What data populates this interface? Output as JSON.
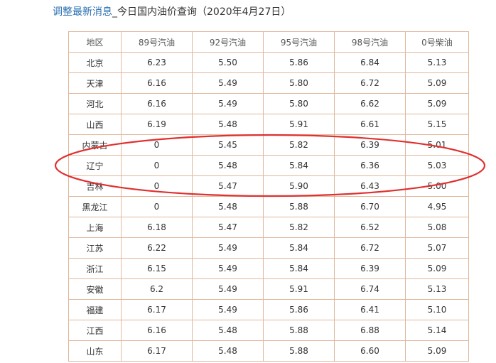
{
  "header": {
    "link_text": "调整最新消息",
    "rest_text": "_今日国内油价查询（2020年4月27日）"
  },
  "table": {
    "columns": [
      "地区",
      "89号汽油",
      "92号汽油",
      "95号汽油",
      "98号汽油",
      "0号柴油"
    ],
    "rows": [
      [
        "北京",
        "6.23",
        "5.50",
        "5.86",
        "6.84",
        "5.13"
      ],
      [
        "天津",
        "6.16",
        "5.49",
        "5.80",
        "6.72",
        "5.09"
      ],
      [
        "河北",
        "6.16",
        "5.49",
        "5.80",
        "6.62",
        "5.09"
      ],
      [
        "山西",
        "6.19",
        "5.48",
        "5.91",
        "6.61",
        "5.15"
      ],
      [
        "内蒙古",
        "0",
        "5.45",
        "5.82",
        "6.39",
        "5.01"
      ],
      [
        "辽宁",
        "0",
        "5.48",
        "5.84",
        "6.36",
        "5.03"
      ],
      [
        "吉林",
        "0",
        "5.47",
        "5.90",
        "6.43",
        "5.00"
      ],
      [
        "黑龙江",
        "0",
        "5.48",
        "5.88",
        "6.70",
        "4.95"
      ],
      [
        "上海",
        "6.18",
        "5.47",
        "5.82",
        "6.52",
        "5.08"
      ],
      [
        "江苏",
        "6.22",
        "5.49",
        "5.84",
        "6.72",
        "5.07"
      ],
      [
        "浙江",
        "6.15",
        "5.49",
        "5.84",
        "6.39",
        "5.09"
      ],
      [
        "安徽",
        "6.2",
        "5.49",
        "5.91",
        "6.74",
        "5.13"
      ],
      [
        "福建",
        "6.17",
        "5.49",
        "5.86",
        "6.41",
        "5.10"
      ],
      [
        "江西",
        "6.16",
        "5.48",
        "5.88",
        "6.88",
        "5.14"
      ],
      [
        "山东",
        "6.17",
        "5.48",
        "5.88",
        "6.60",
        "5.09"
      ]
    ]
  },
  "annotation": {
    "color": "#e03030"
  }
}
